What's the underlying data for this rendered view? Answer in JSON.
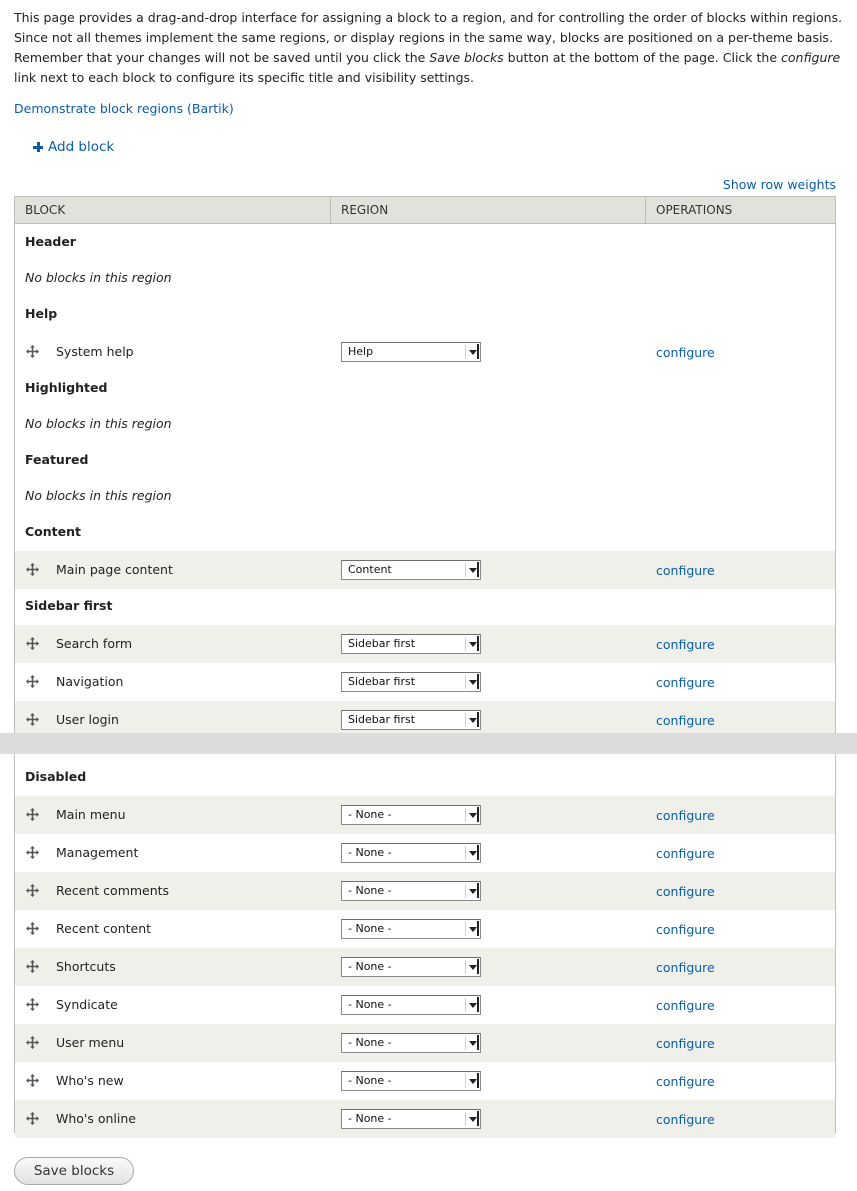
{
  "intro": {
    "part1": "This page provides a drag-and-drop interface for assigning a block to a region, and for controlling the order of blocks within regions. Since not all themes implement the same regions, or display regions in the same way, blocks are positioned on a per-theme basis. Remember that your changes will not be saved until you click the ",
    "save_emphasis": "Save blocks",
    "part2": " button at the bottom of the page. Click the ",
    "configure_emphasis": "configure",
    "part3": " link next to each block to configure its specific title and visibility settings."
  },
  "demo_link": "Demonstrate block regions (Bartik)",
  "add_block": "Add block",
  "show_weights": "Show row weights",
  "table": {
    "headers": {
      "block": "BLOCK",
      "region": "REGION",
      "operations": "OPERATIONS"
    },
    "empty_message": "No blocks in this region",
    "configure_label": "configure"
  },
  "regions": [
    {
      "title": "Header",
      "blocks": []
    },
    {
      "title": "Help",
      "blocks": [
        {
          "name": "System help",
          "region": "Help"
        }
      ]
    },
    {
      "title": "Highlighted",
      "blocks": []
    },
    {
      "title": "Featured",
      "blocks": []
    },
    {
      "title": "Content",
      "blocks": [
        {
          "name": "Main page content",
          "region": "Content"
        }
      ]
    },
    {
      "title": "Sidebar first",
      "blocks": [
        {
          "name": "Search form",
          "region": "Sidebar first"
        },
        {
          "name": "Navigation",
          "region": "Sidebar first"
        },
        {
          "name": "User login",
          "region": "Sidebar first"
        }
      ]
    },
    {
      "title": "Disabled",
      "blocks": [
        {
          "name": "Main menu",
          "region": "- None -"
        },
        {
          "name": "Management",
          "region": "- None -"
        },
        {
          "name": "Recent comments",
          "region": "- None -"
        },
        {
          "name": "Recent content",
          "region": "- None -"
        },
        {
          "name": "Shortcuts",
          "region": "- None -"
        },
        {
          "name": "Syndicate",
          "region": "- None -"
        },
        {
          "name": "User menu",
          "region": "- None -"
        },
        {
          "name": "Who's new",
          "region": "- None -"
        },
        {
          "name": "Who's online",
          "region": "- None -"
        }
      ]
    }
  ],
  "save_button": "Save blocks",
  "colors": {
    "link": "#0a5ea8",
    "header_bg": "#e1e2dc",
    "stripe_bg": "#f0f0eb",
    "border": "#bfbfba"
  }
}
